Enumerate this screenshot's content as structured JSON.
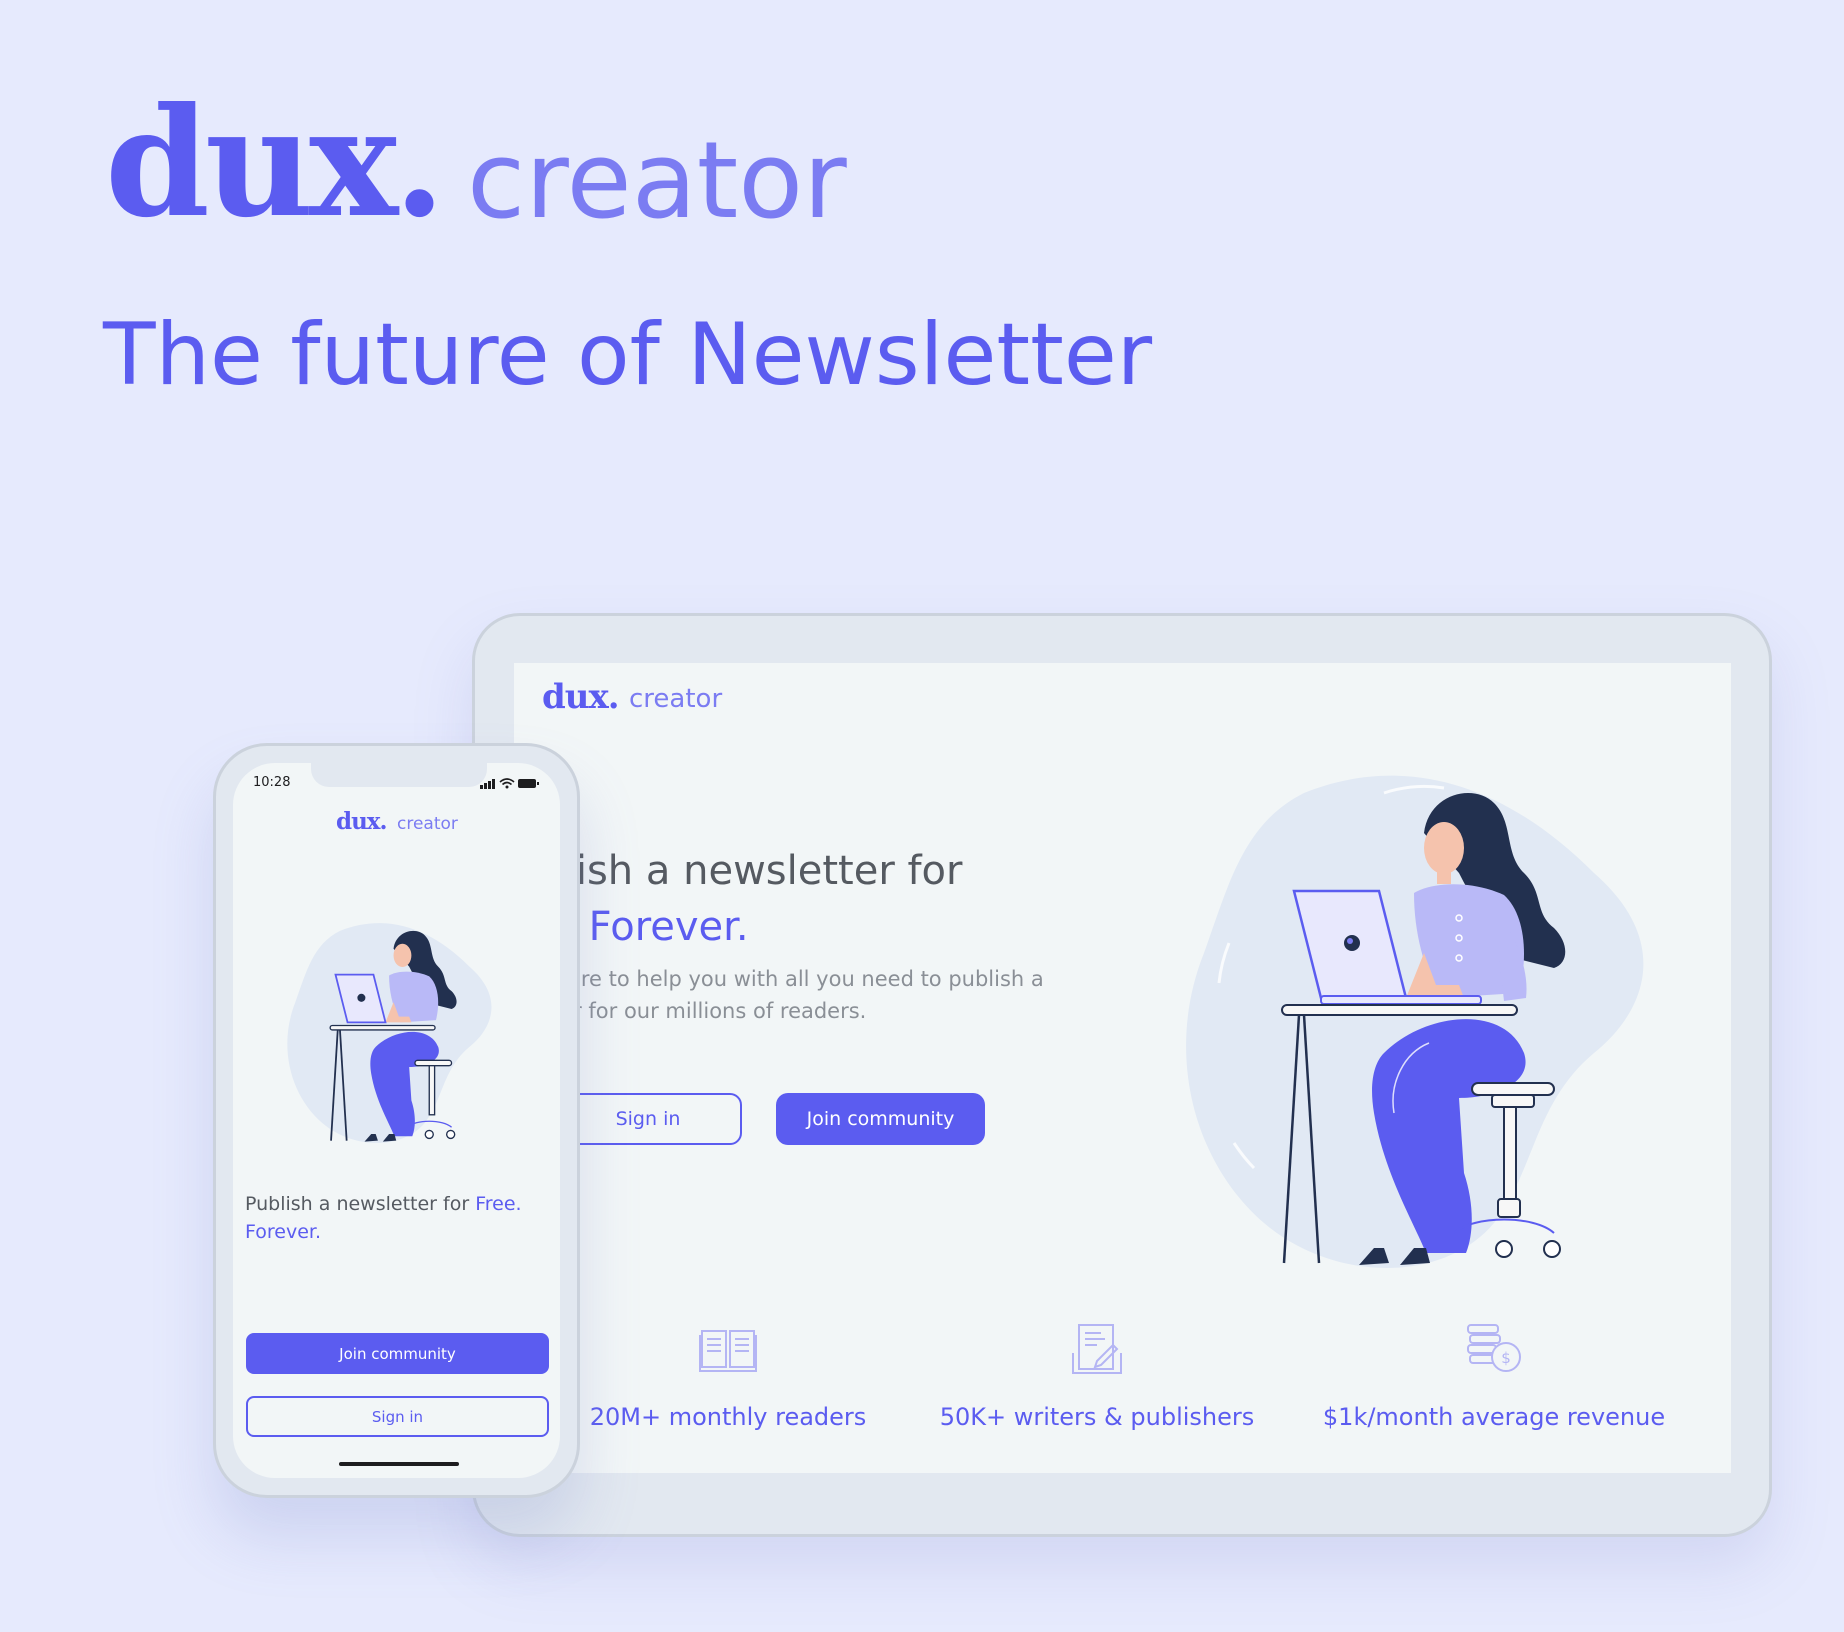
{
  "brand": {
    "name": "dux.",
    "product": "creator",
    "tagline": "The future of Newsletter"
  },
  "tablet": {
    "logo": {
      "name": "dux.",
      "product": "creator"
    },
    "headline": {
      "line1": "ublish a newsletter for",
      "line2": "ee. Forever."
    },
    "subtext": {
      "line1": "are here to help you with all you need to publish a",
      "line2": "sletter for our millions of readers."
    },
    "buttons": {
      "sign_in": "Sign in",
      "join": "Join community"
    },
    "stats": [
      {
        "icon": "open-book-icon",
        "label": "20M+ monthly readers"
      },
      {
        "icon": "document-edit-icon",
        "label": "50K+ writers & publishers"
      },
      {
        "icon": "coins-dollar-icon",
        "label": "$1k/month average revenue"
      }
    ]
  },
  "phone": {
    "status": {
      "time": "10:28"
    },
    "logo": {
      "name": "dux.",
      "product": "creator"
    },
    "headline": {
      "plain": "Publish a newsletter for ",
      "accent": "Free. Forever."
    },
    "buttons": {
      "join": "Join community",
      "sign_in": "Sign in"
    }
  },
  "colors": {
    "background": "#e6eafd",
    "accent": "#5b5cf0",
    "accent_light": "#7b7cf2",
    "screen": "#f2f6f7",
    "device_frame": "#e2e8f0"
  }
}
